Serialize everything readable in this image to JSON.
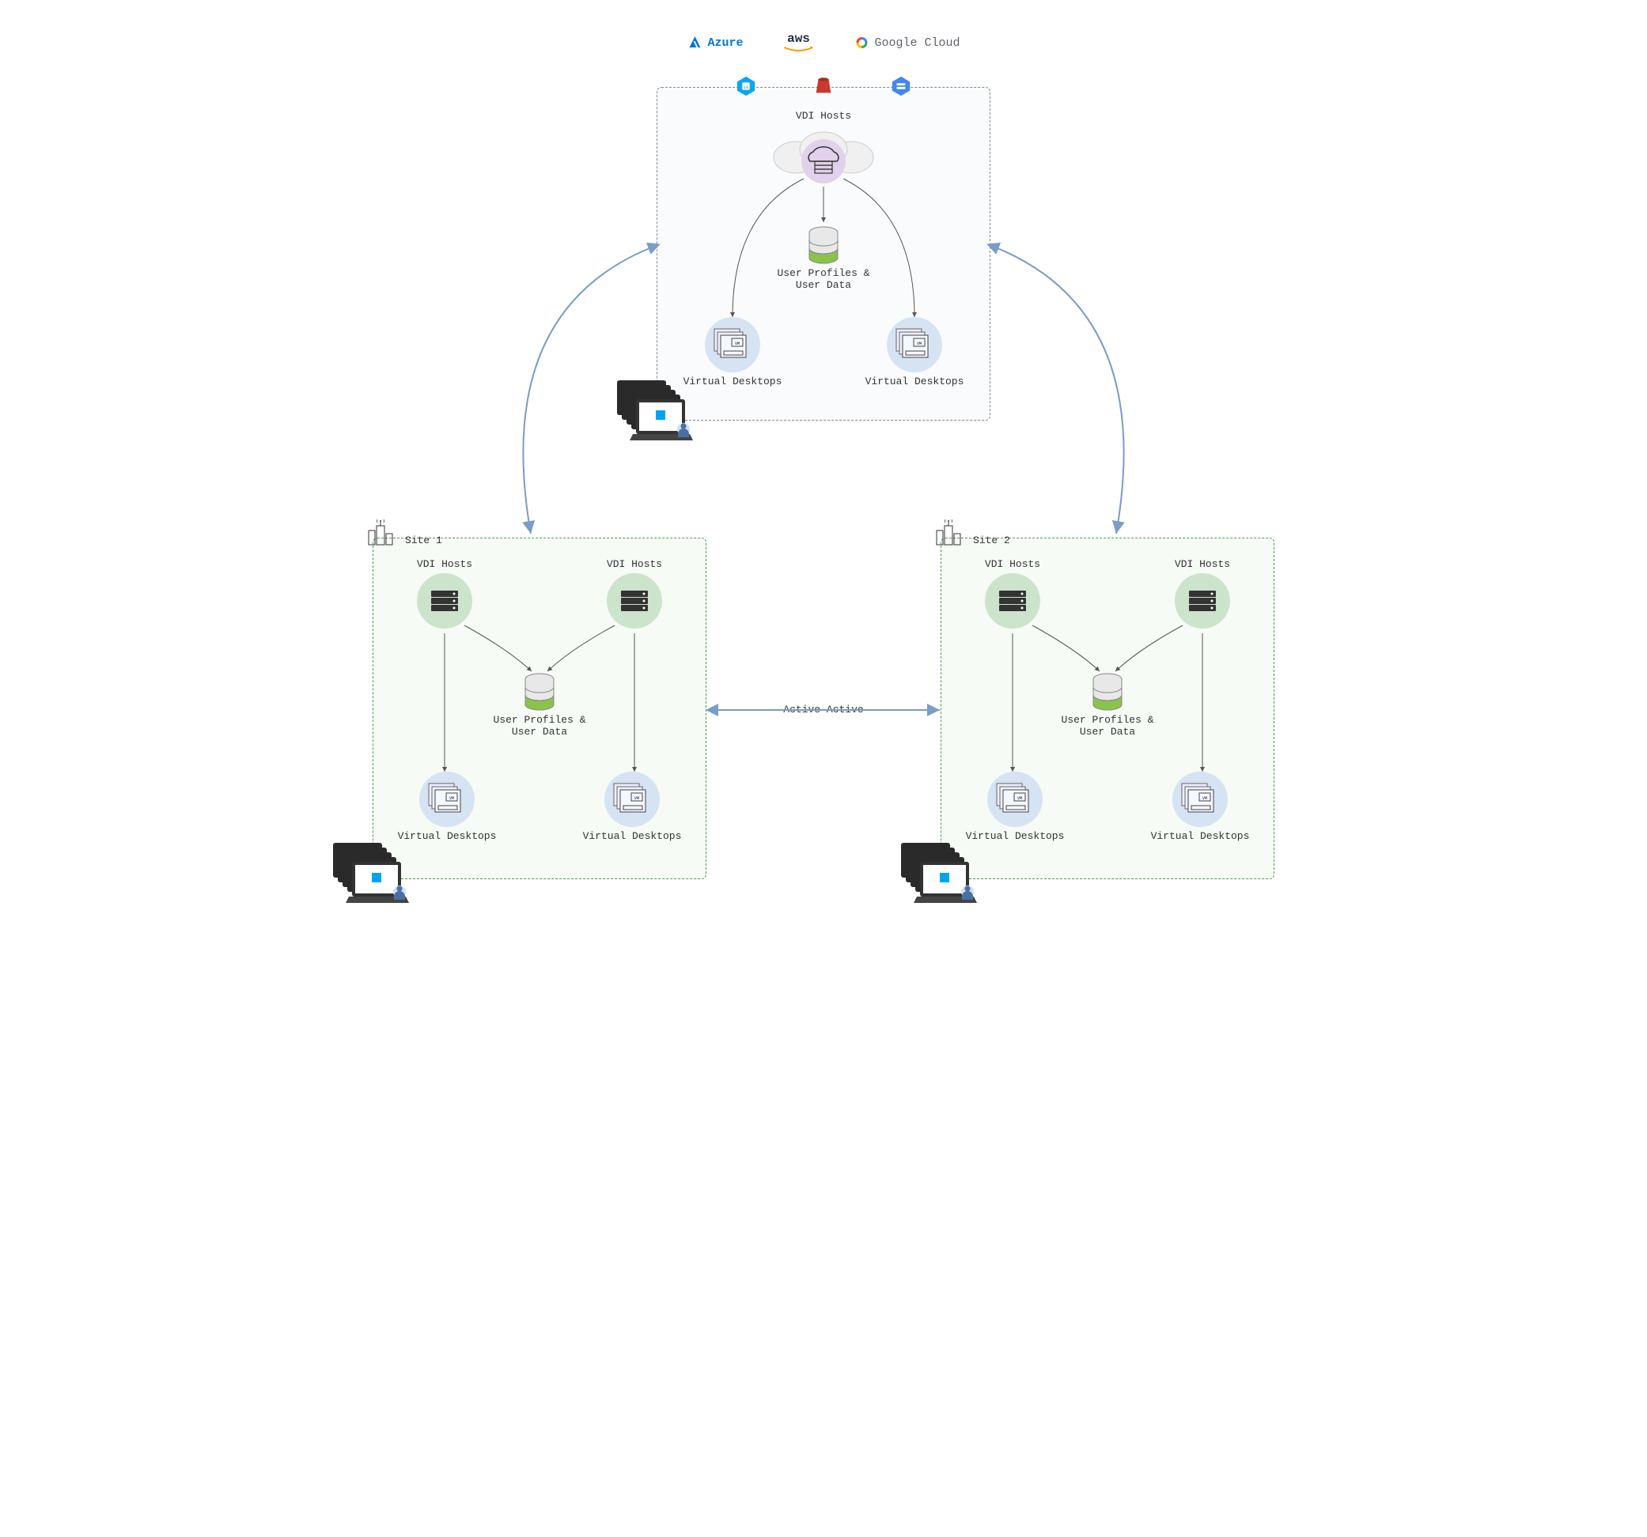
{
  "cloudProviders": {
    "azure": "Azure",
    "aws": "aws",
    "gcp": "Google Cloud"
  },
  "cloudBox": {
    "vdiHosts": "VDI Hosts",
    "userData": "User Profiles &\nUser Data",
    "virtualDesktops": "Virtual Desktops"
  },
  "site1": {
    "label": "Site 1",
    "vdiHosts": "VDI Hosts",
    "userData": "User Profiles &\nUser Data",
    "virtualDesktops": "Virtual Desktops"
  },
  "site2": {
    "label": "Site 2",
    "vdiHosts": "VDI Hosts",
    "userData": "User Profiles &\nUser Data",
    "virtualDesktops": "Virtual Desktops"
  },
  "connections": {
    "activeActive": "Active-Active"
  }
}
